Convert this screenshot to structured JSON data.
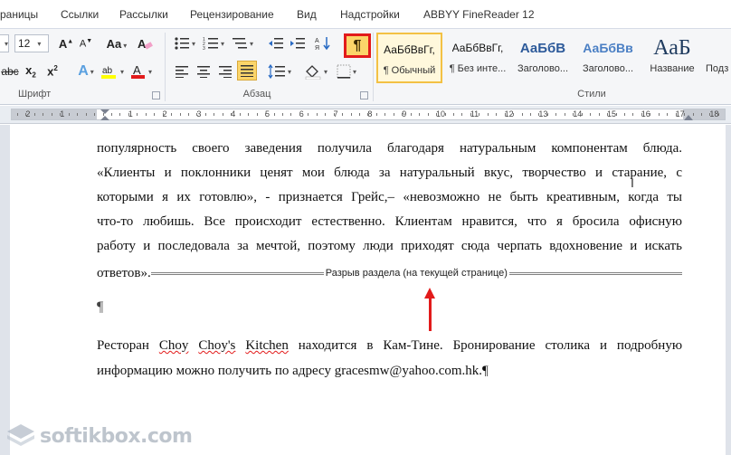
{
  "tabs": [
    "раницы",
    "Ссылки",
    "Рассылки",
    "Рецензирование",
    "Вид",
    "Надстройки",
    "ABBYY FineReader 12"
  ],
  "ribbon": {
    "font_size": "12",
    "groups": {
      "font": "Шрифт",
      "paragraph": "Абзац",
      "styles": "Стили"
    },
    "pilcrow_label": "¶",
    "styles": [
      {
        "sample": "АаБбВвГг,",
        "name": "¶ Обычный"
      },
      {
        "sample": "АаБбВвГг,",
        "name": "¶ Без инте..."
      },
      {
        "sample": "АаБбВ",
        "name": "Заголово..."
      },
      {
        "sample": "АаБбВв",
        "name": "Заголово..."
      },
      {
        "sample": "АаБ",
        "name": "Название"
      },
      {
        "sample": "",
        "name": "Подз"
      }
    ]
  },
  "ruler_numbers": [
    "2",
    "1",
    "1",
    "2",
    "3",
    "4",
    "5",
    "6",
    "7",
    "8",
    "9",
    "10",
    "11",
    "12",
    "13",
    "14",
    "15",
    "16",
    "17",
    "18"
  ],
  "document": {
    "lines": [
      "популярность своего заведения получила благодаря натуральным компонентам блюда.",
      "«Клиенты и поклонники ценят мои блюда за натуральный вкус, творчество и старание, с",
      "которыми я их готовлю», - признается Грейс,– «невозможно не быть креативным, когда ты",
      "что-то любишь. Все происходит естественно. Клиентам нравится, что я бросила офисную",
      "работу и последовала за мечтой, поэтому люди приходят сюда черпать вдохновение и искать"
    ],
    "last_line_before_break": "ответов».",
    "section_break": "Разрыв раздела (на текущей странице)",
    "empty_paragraph_mark": "¶",
    "p2_line1": {
      "pre": "Ресторан ",
      "w1": "Choy",
      "mid1": " ",
      "w2": "Choy's",
      "mid2": " ",
      "w3": "Kitchen",
      "post": " находится в Кам-Тине. Бронирование столика и подробную"
    },
    "p2_line2": "информацию можно получить по адресу gracesmw@yahoo.com.hk.¶"
  },
  "colors": {
    "accent_red": "#e21b1b",
    "pilcrow_bg": "#fbd56a",
    "style_active_border": "#f3c144"
  },
  "icons": [
    "bullets-icon",
    "numbering-icon",
    "multilevel-list-icon",
    "decrease-indent-icon",
    "increase-indent-icon",
    "sort-icon",
    "show-formatting-icon",
    "align-left-icon",
    "align-center-icon",
    "align-right-icon",
    "justify-icon",
    "line-spacing-icon",
    "shading-icon",
    "borders-icon",
    "grow-font-icon",
    "shrink-font-icon",
    "change-case-icon",
    "clear-format-icon",
    "strikethrough-icon",
    "subscript-icon",
    "superscript-icon",
    "text-effects-icon",
    "highlight-icon",
    "font-color-icon",
    "arrow-up-icon",
    "i-beam-cursor-icon"
  ],
  "watermark": "softikbox.com"
}
